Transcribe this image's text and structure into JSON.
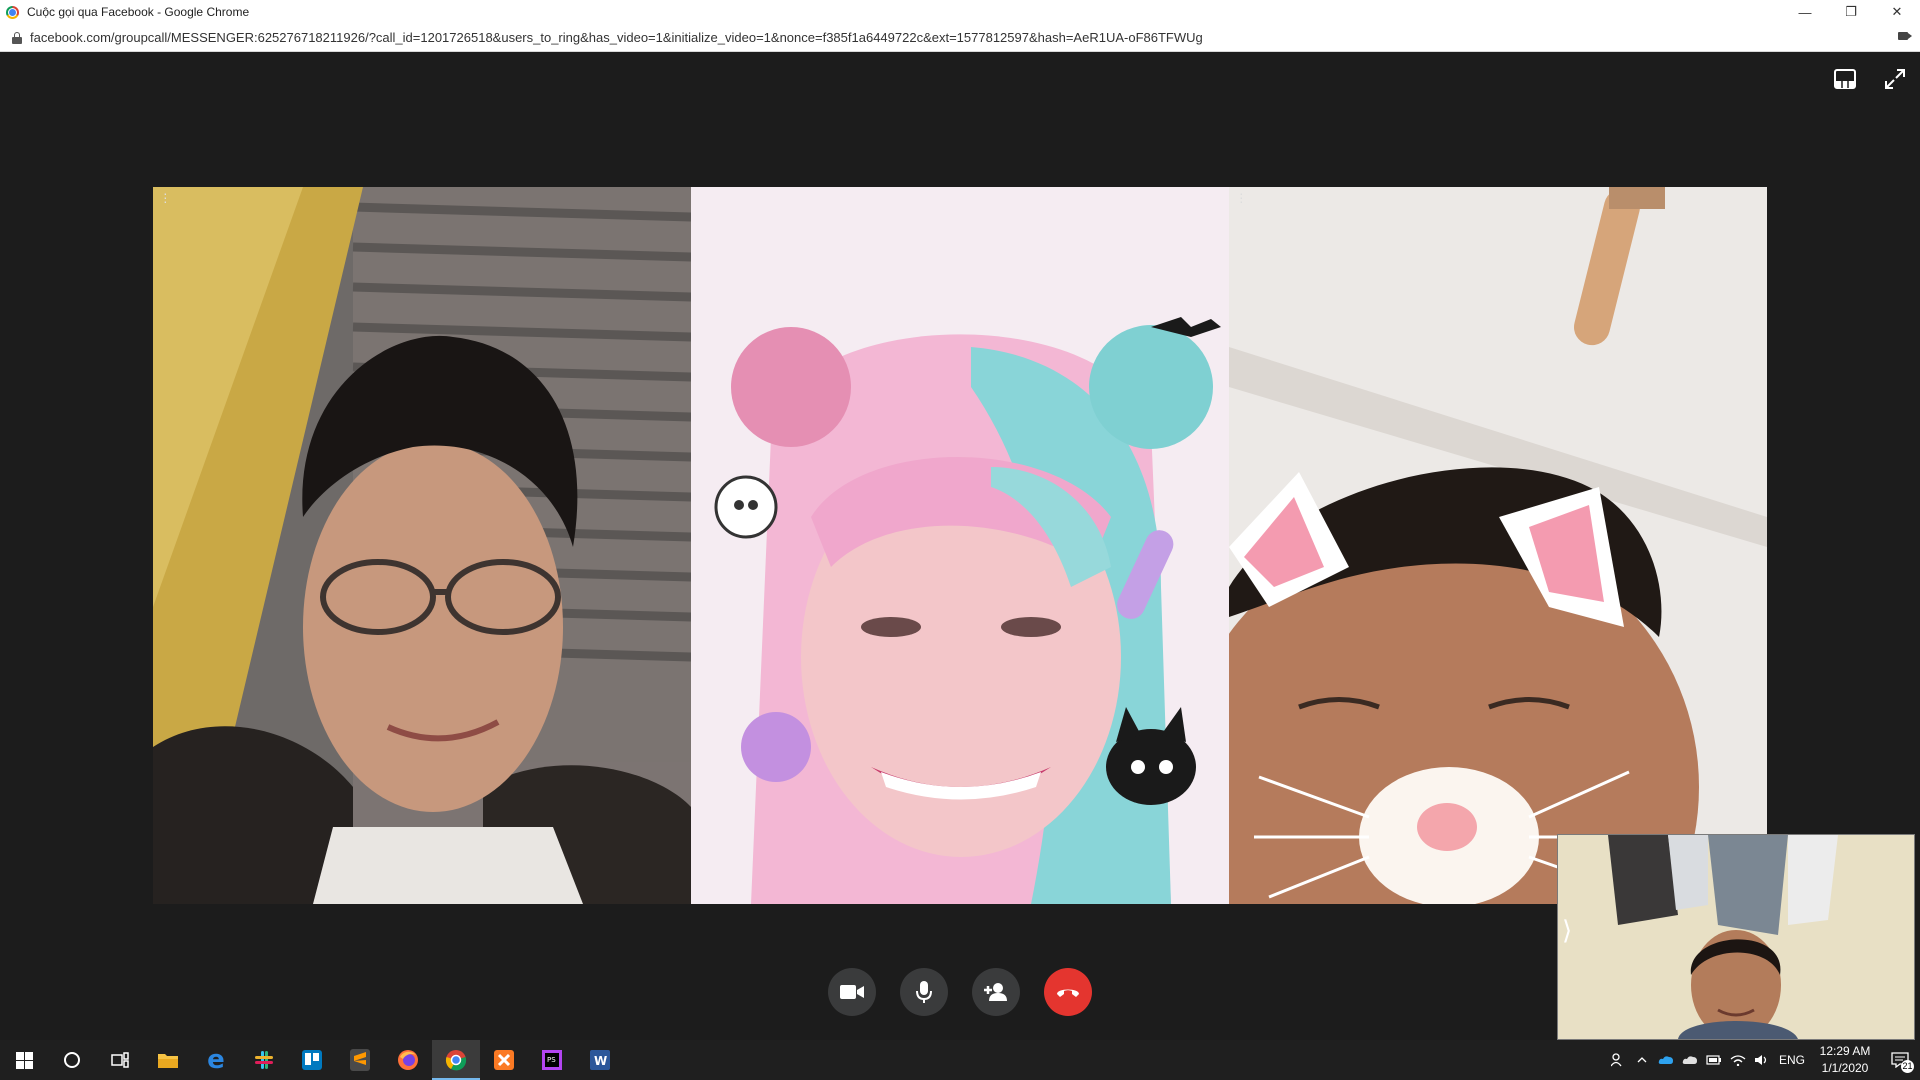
{
  "window": {
    "title": "Cuộc gọi qua Facebook - Google Chrome",
    "controls": [
      "—",
      "❐",
      "✕"
    ]
  },
  "browser": {
    "url": "facebook.com/groupcall/MESSENGER:625276718211926/?call_id=1201726518&users_to_ring&has_video=1&initialize_video=1&nonce=f385f1a6449722c&ext=1577812597&hash=AeR1UA-oF86TFWUg"
  },
  "call": {
    "top_icons": [
      "layout-icon",
      "fullscreen-icon"
    ],
    "participants": [
      {
        "name": "participant-1",
        "scene": "man with glasses in front of shutters"
      },
      {
        "name": "participant-2",
        "scene": "anime filter with pastel wig"
      },
      {
        "name": "participant-3",
        "scene": "cat ears filter"
      }
    ],
    "controls": [
      "video-camera-icon",
      "microphone-icon",
      "add-person-icon",
      "end-call-icon"
    ],
    "colors": {
      "stage": "#1c1c1c",
      "button": "#3a3b3c",
      "end_call": "#e4352f"
    }
  },
  "taskbar": {
    "apps": [
      "start-icon",
      "cortana-icon",
      "task-view-icon",
      "file-explorer-icon",
      "edge-icon",
      "slack-icon",
      "trello-icon",
      "sublime-icon",
      "firefox-icon",
      "chrome-icon",
      "xampp-icon",
      "phpstorm-icon",
      "word-icon"
    ],
    "active_app": "chrome-icon",
    "tray": {
      "language": "ENG",
      "time": "12:29 AM",
      "date": "1/1/2020",
      "notification_count": "21"
    }
  }
}
